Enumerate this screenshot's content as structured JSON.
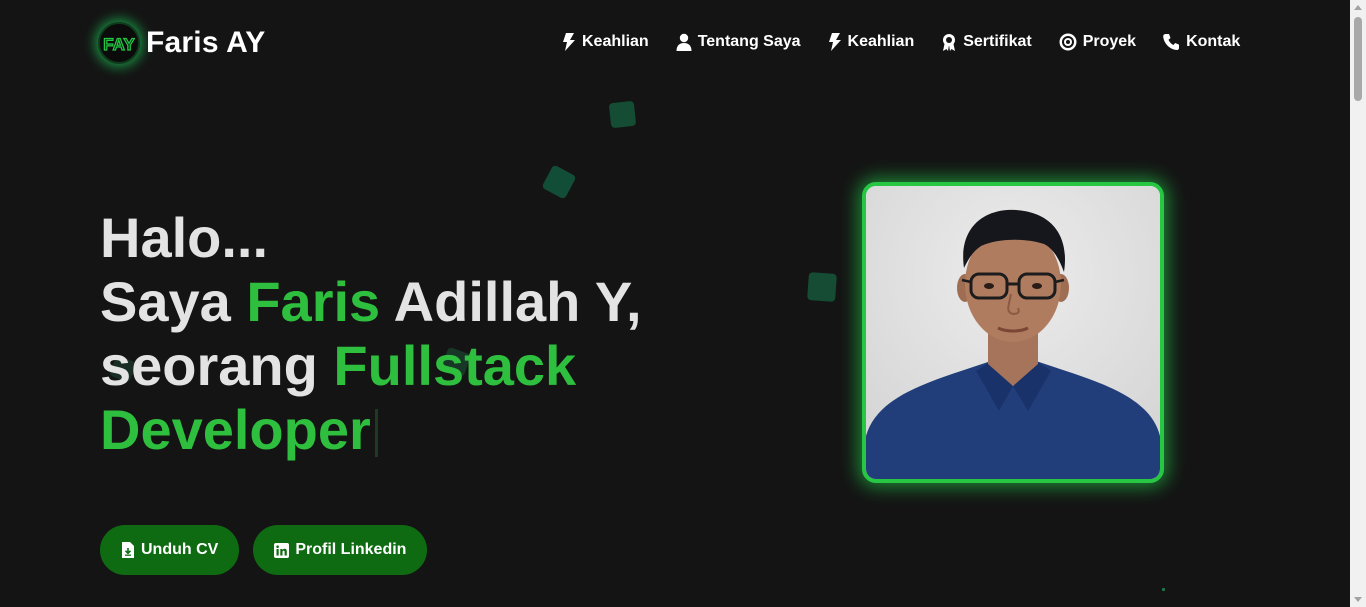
{
  "brand": {
    "logo_text": "FAY",
    "name": "Faris AY"
  },
  "nav": {
    "items": [
      {
        "label": "Keahlian",
        "icon": "bolt-icon"
      },
      {
        "label": "Tentang Saya",
        "icon": "user-icon"
      },
      {
        "label": "Keahlian",
        "icon": "bolt-icon"
      },
      {
        "label": "Sertifikat",
        "icon": "award-icon"
      },
      {
        "label": "Proyek",
        "icon": "target-icon"
      },
      {
        "label": "Kontak",
        "icon": "phone-icon"
      }
    ]
  },
  "hero": {
    "line1": "Halo...",
    "line2_prefix": "Saya ",
    "line2_highlight": "Faris",
    "line2_suffix": " Adillah Y,",
    "line3_prefix": "seorang ",
    "line3_highlight": "Fullstack",
    "line4_highlight": "Developer"
  },
  "buttons": {
    "download_cv": {
      "label": "Unduh CV",
      "icon": "file-download-icon"
    },
    "linkedin": {
      "label": "Profil Linkedin",
      "icon": "linkedin-icon"
    }
  },
  "colors": {
    "background": "#141414",
    "accent_green": "#2fbf3e",
    "button_green": "#0f6b12",
    "frame_green": "#27c744",
    "text": "#e3e3e3"
  }
}
